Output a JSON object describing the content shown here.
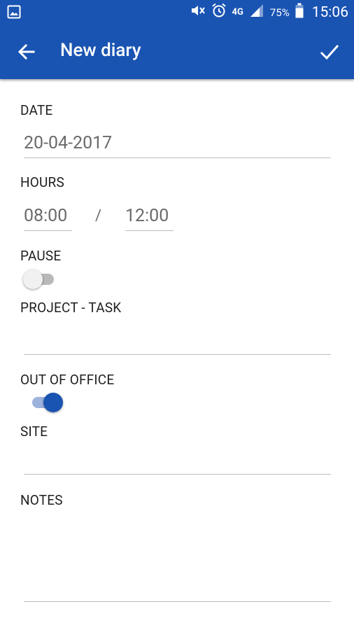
{
  "status_bar": {
    "left_icon": "gallery-icon",
    "icons": [
      "mute-icon",
      "alarm-icon",
      "signal-icon",
      "battery-icon"
    ],
    "network": "4G",
    "battery": "75%",
    "time": "15:06"
  },
  "app_bar": {
    "title": "New diary",
    "back_icon": "arrow-left-icon",
    "confirm_icon": "check-icon",
    "background_color": "#1a54b3"
  },
  "form": {
    "date": {
      "label": "DATE",
      "value": "20-04-2017"
    },
    "hours": {
      "label": "HOURS",
      "start": "08:00",
      "separator": "/",
      "end": "12:00"
    },
    "pause": {
      "label": "PAUSE",
      "enabled": false
    },
    "project_task": {
      "label": "PROJECT - TASK",
      "value": ""
    },
    "out_of_office": {
      "label": "OUT OF OFFICE",
      "enabled": true
    },
    "site": {
      "label": "SITE",
      "value": ""
    },
    "notes": {
      "label": "NOTES",
      "value": ""
    }
  }
}
